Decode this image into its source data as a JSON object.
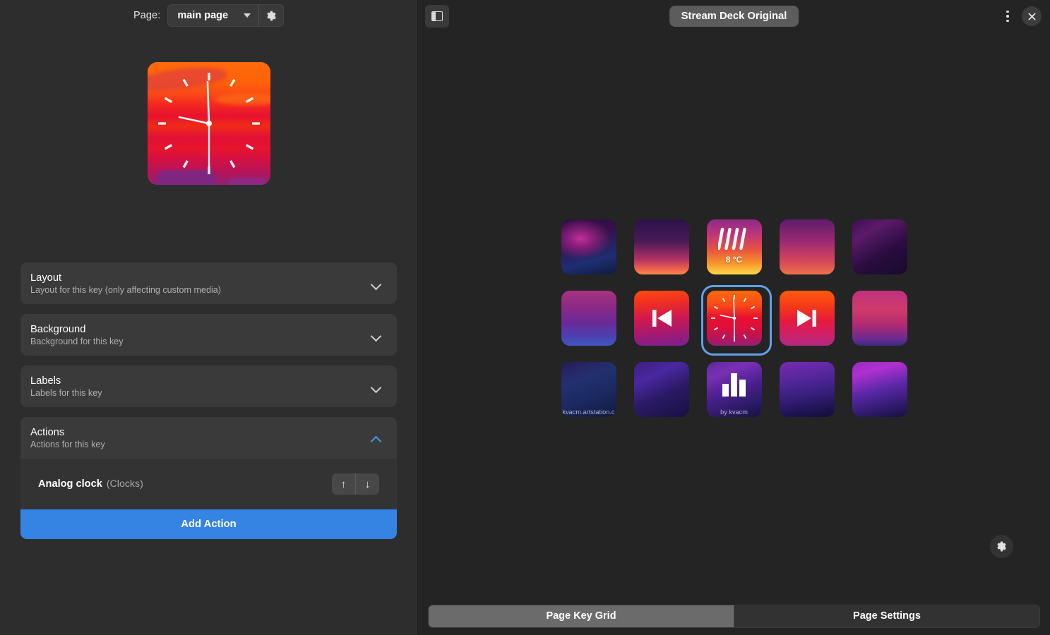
{
  "left": {
    "header": {
      "page_label": "Page:",
      "page_value": "main page",
      "gear_icon": "gear-icon",
      "caret_icon": "chevron-down-icon"
    },
    "preview": {
      "key_name": "analog-clock-preview",
      "time": {
        "hour_angle": 282,
        "minute_angle": 358,
        "second_angle": 180
      }
    },
    "expanders": [
      {
        "title": "Layout",
        "subtitle": "Layout for this key (only affecting custom media)",
        "expanded": false
      },
      {
        "title": "Background",
        "subtitle": "Background for this key",
        "expanded": false
      },
      {
        "title": "Labels",
        "subtitle": "Labels for this key",
        "expanded": false
      },
      {
        "title": "Actions",
        "subtitle": "Actions for this key",
        "expanded": true
      }
    ],
    "actions": {
      "items": [
        {
          "name": "Analog clock",
          "category": "(Clocks)",
          "move_up": "↑",
          "move_down": "↓"
        }
      ],
      "add_label": "Add Action"
    }
  },
  "right": {
    "header": {
      "sidebar_toggle_icon": "sidebar-toggle-icon",
      "title": "Stream Deck Original",
      "menu_icon": "more-vertical-icon",
      "close_icon": "close-icon"
    },
    "grid": {
      "rows": 3,
      "cols": 5,
      "selected_index": 7,
      "keys": [
        {
          "name": "key-1-1",
          "art": "nebula-purple",
          "icon": "none",
          "caption": ""
        },
        {
          "name": "key-1-2",
          "art": "city-dusk",
          "icon": "none",
          "caption": ""
        },
        {
          "name": "key-1-3",
          "art": "sunset-gold",
          "icon": "rain",
          "caption": "8 °C"
        },
        {
          "name": "key-1-4",
          "art": "magenta-sky",
          "icon": "none",
          "caption": ""
        },
        {
          "name": "key-1-5",
          "art": "dark-violet",
          "icon": "none",
          "caption": ""
        },
        {
          "name": "key-2-1",
          "art": "ruins-violet",
          "icon": "none",
          "caption": ""
        },
        {
          "name": "key-2-2",
          "art": "city-red",
          "icon": "previous",
          "caption": ""
        },
        {
          "name": "key-2-3",
          "art": "sunset-clock",
          "icon": "clock",
          "caption": ""
        },
        {
          "name": "key-2-4",
          "art": "sunset-red",
          "icon": "next",
          "caption": ""
        },
        {
          "name": "key-2-5",
          "art": "pink-horizon",
          "icon": "none",
          "caption": ""
        },
        {
          "name": "key-3-1",
          "art": "blue-swirl",
          "icon": "none",
          "caption": "kvacm.artstation.c"
        },
        {
          "name": "key-3-2",
          "art": "indigo-wave",
          "icon": "none",
          "caption": ""
        },
        {
          "name": "key-3-3",
          "art": "violet-stream",
          "icon": "bars",
          "caption": "by kvacm"
        },
        {
          "name": "key-3-4",
          "art": "night-road",
          "icon": "none",
          "caption": ""
        },
        {
          "name": "key-3-5",
          "art": "neon-city",
          "icon": "none",
          "caption": ""
        }
      ],
      "fab_icon": "gear-icon"
    },
    "tabs": [
      {
        "label": "Page Key Grid",
        "active": true
      },
      {
        "label": "Page Settings",
        "active": false
      }
    ]
  },
  "colors": {
    "accent": "#3584e4",
    "selection": "#62a0ea",
    "left_bg": "#2d2d2d",
    "right_bg": "#242424"
  }
}
